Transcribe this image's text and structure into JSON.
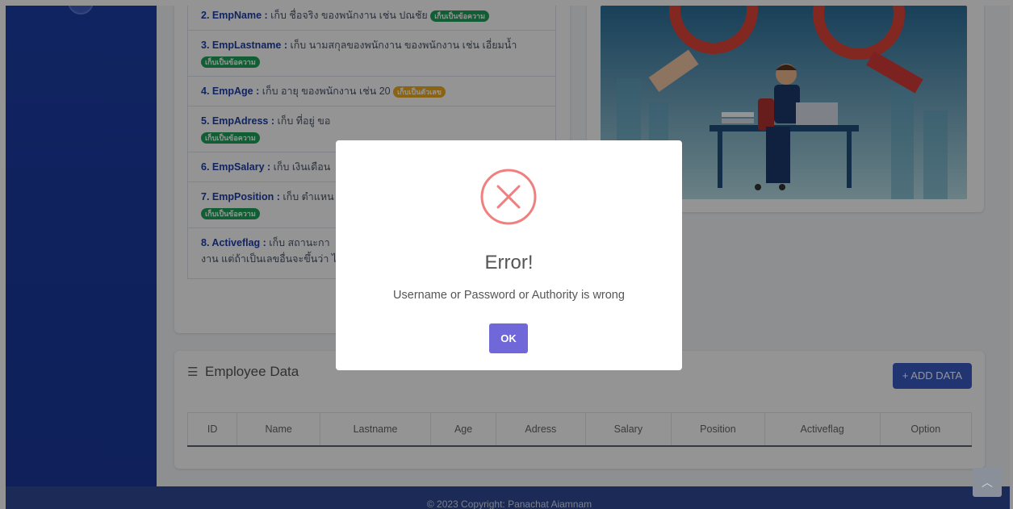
{
  "fields": [
    {
      "name": "2. EmpName :",
      "desc": " เก็บ ชื่อจริง ของพนักงาน เช่น ปณชัย ",
      "badge": "เก็บเป็นข้อความ",
      "badge_color": "green"
    },
    {
      "name": "3. EmpLastname :",
      "desc": " เก็บ นามสกุลของพนักงาน ของพนักงาน เช่น เอี่ยมน้ำ ",
      "badge": "เก็บเป็นข้อความ",
      "badge_color": "green"
    },
    {
      "name": "4. EmpAge :",
      "desc": " เก็บ อายุ ของพนักงาน เช่น 20 ",
      "badge": "เก็บเป็นตัวเลข",
      "badge_color": "orange"
    },
    {
      "name": "5. EmpAdress :",
      "desc": " เก็บ ที่อยู่ ขอ",
      "badge": "เก็บเป็นข้อความ",
      "badge_color": "green"
    },
    {
      "name": "6. EmpSalary :",
      "desc": " เก็บ เงินเดือน",
      "badge": "",
      "badge_color": ""
    },
    {
      "name": "7. EmpPosition :",
      "desc": " เก็บ ตำแหน",
      "badge": "เก็บเป็นข้อความ",
      "badge_color": "green"
    },
    {
      "name": "8. Activeflag :",
      "desc": " เก็บ สถานะกา",
      "desc2": "งาน แต่ถ้าเป็นเลขอื่นจะขึ้นว่า ไ",
      "badge": "",
      "badge_color": ""
    }
  ],
  "employee": {
    "title": "Employee Data",
    "add_button": "+ ADD DATA",
    "columns": [
      "ID",
      "Name",
      "Lastname",
      "Age",
      "Adress",
      "Salary",
      "Position",
      "Activeflag",
      "Option"
    ]
  },
  "footer": {
    "text": "© 2023 Copyright: Panachat Aiamnam"
  },
  "modal": {
    "title": "Error!",
    "message": "Username or Password or Authority is wrong",
    "ok_label": "OK"
  },
  "icons": {
    "error": "x-circle-icon",
    "scroll": "chevron-up-icon",
    "list": "list-check-icon"
  },
  "colors": {
    "sidebar": "#1d3fa8",
    "field_name": "#1f3fa6",
    "badge_green": "#20a25a",
    "badge_orange": "#f0ad22",
    "add_button": "#3b5cc7",
    "ok_button": "#7067d9",
    "error_icon": "#f08080",
    "footer": "#2f4994"
  }
}
